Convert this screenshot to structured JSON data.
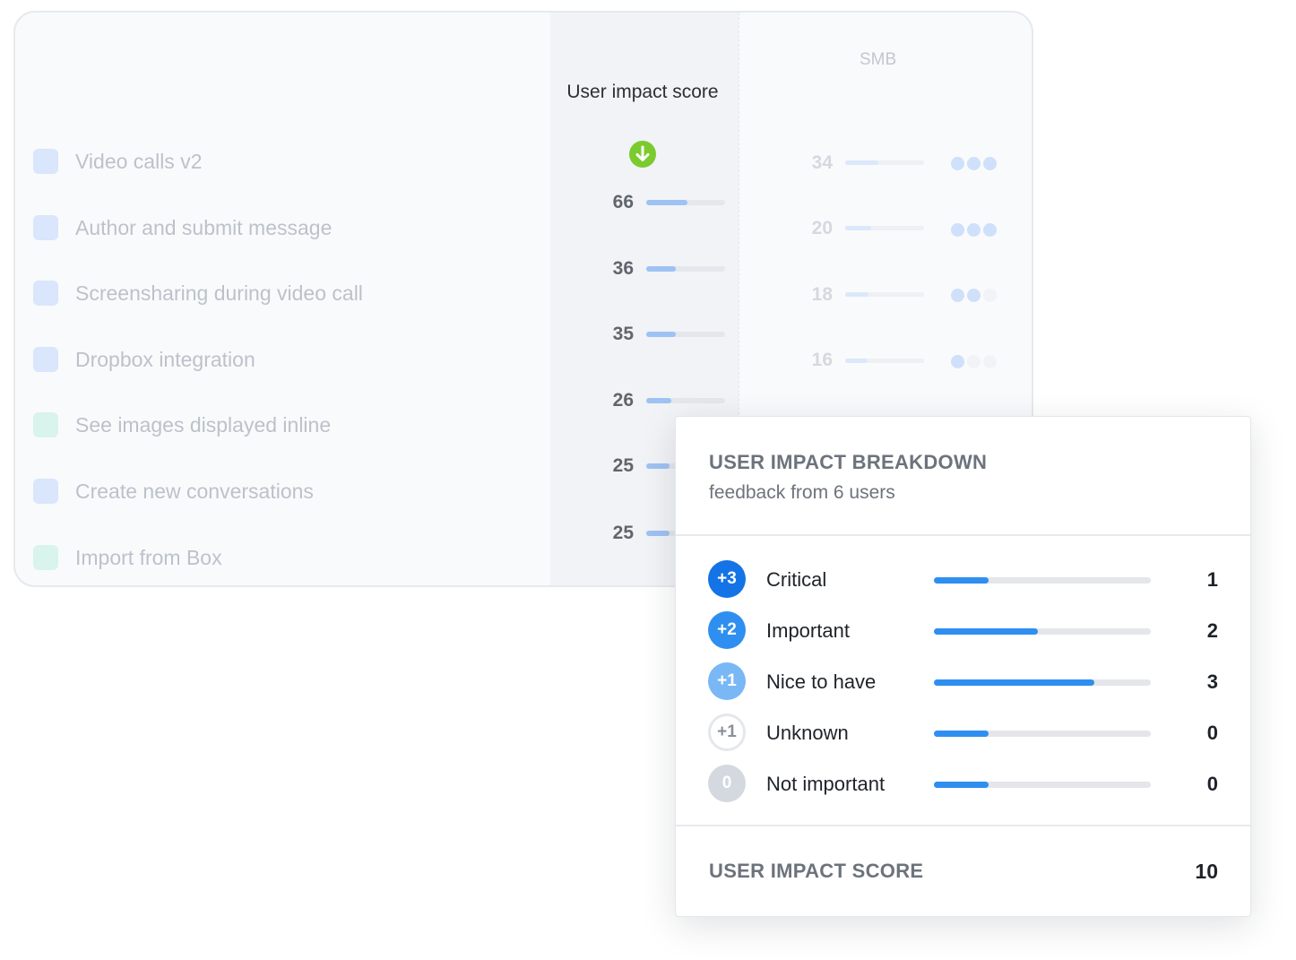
{
  "table": {
    "segment_header": "SMB",
    "score_header": "User impact score",
    "sort_icon": "arrow-down-icon",
    "rows": [
      {
        "label": "Video calls v2",
        "score": null,
        "smb": 34,
        "smb_dots": 3,
        "check_color": "#d9e6fb"
      },
      {
        "label": "Author and submit message",
        "score": 66,
        "smb": 20,
        "smb_dots": 3,
        "check_color": "#d9e6fb"
      },
      {
        "label": "Screensharing during video call",
        "score": 36,
        "smb": 18,
        "smb_dots": 2,
        "check_color": "#d9e6fb"
      },
      {
        "label": "Dropbox integration",
        "score": 35,
        "smb": 16,
        "smb_dots": 1,
        "check_color": "#d9e6fb"
      },
      {
        "label": "See images displayed inline",
        "score": 26,
        "smb": null,
        "smb_dots": 0,
        "check_color": "#d8f4ec"
      },
      {
        "label": "Create new conversations",
        "score": 25,
        "smb": null,
        "smb_dots": 0,
        "check_color": "#d9e6fb"
      },
      {
        "label": "Import from Box",
        "score": 25,
        "smb": null,
        "smb_dots": 0,
        "check_color": "#d8f4ec"
      }
    ],
    "score_values": [
      "66",
      "36",
      "35",
      "26",
      "25",
      "25"
    ],
    "score_fill_fraction": [
      0.52,
      0.38,
      0.37,
      0.32,
      0.3,
      0.3
    ],
    "smb_values": [
      "34",
      "20",
      "18",
      "16"
    ],
    "smb_fill_fraction": [
      0.42,
      0.33,
      0.3,
      0.28
    ],
    "smb_dot_counts": [
      3,
      3,
      2,
      1
    ]
  },
  "popover": {
    "title": "USER IMPACT BREAKDOWN",
    "subtitle": "feedback from 6 users",
    "rows": [
      {
        "badge": "+3",
        "label": "Critical",
        "count": "1",
        "fill_fraction": 0.25,
        "badge_color": "#1473e6",
        "badge_style": "solid"
      },
      {
        "badge": "+2",
        "label": "Important",
        "count": "2",
        "fill_fraction": 0.48,
        "badge_color": "#2e8ff0",
        "badge_style": "solid"
      },
      {
        "badge": "+1",
        "label": "Nice to have",
        "count": "3",
        "fill_fraction": 0.74,
        "badge_color": "#7ab8f5",
        "badge_style": "solid"
      },
      {
        "badge": "+1",
        "label": "Unknown",
        "count": "0",
        "fill_fraction": 0.25,
        "badge_color": "#ffffff",
        "badge_style": "outline"
      },
      {
        "badge": "0",
        "label": "Not important",
        "count": "0",
        "fill_fraction": 0.25,
        "badge_color": "#d4d9df",
        "badge_style": "solid"
      }
    ],
    "total_label": "USER IMPACT SCORE",
    "total_value": "10"
  }
}
